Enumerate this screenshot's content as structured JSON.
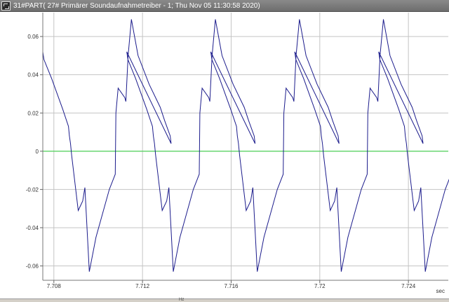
{
  "window": {
    "title": "31#PART( 27# Primärer Soundaufnahmetreiber - 1; Thu Nov 05 11:30:58 2020)"
  },
  "statusbar": {
    "text": "Hz"
  },
  "colors": {
    "signal": "#1c1c8c",
    "zero_line": "#3fd14a",
    "grid": "#c4c4c4",
    "plot_bg": "#ffffff"
  },
  "chart_data": {
    "type": "line",
    "xlabel": "sec",
    "ylabel": "",
    "xlim": [
      7.7075,
      7.7258
    ],
    "ylim": [
      -0.0675,
      0.0725
    ],
    "xticks": [
      "7.708",
      "7.712",
      "7.716",
      "7.72",
      "7.724"
    ],
    "xtick_values": [
      7.708,
      7.712,
      7.716,
      7.72,
      7.724
    ],
    "yticks": [
      "0.06",
      "0.04",
      "0.02",
      "0",
      "-0.02",
      "-0.04",
      "-0.06"
    ],
    "ytick_values": [
      0.06,
      0.04,
      0.02,
      0,
      -0.02,
      -0.04,
      -0.06
    ],
    "grid": true,
    "zero_line": true,
    "period": 0.00379,
    "series": [
      {
        "values_x": [
          7.7075,
          7.70755,
          7.7079,
          7.7084,
          7.70866,
          7.7087,
          7.70875,
          7.7088,
          7.7091,
          7.7093,
          7.7094,
          7.7096,
          7.7099,
          7.7105,
          7.71077,
          7.7108,
          7.7109,
          7.7112,
          7.71125,
          7.71135,
          7.7115,
          7.7118,
          7.7123,
          7.7128,
          7.713,
          7.71325,
          7.71329
        ],
        "values_y": [
          0.052,
          0.048,
          0.038,
          0.022,
          0.013,
          0.008,
          0.004,
          -0.002,
          -0.031,
          -0.026,
          -0.019,
          -0.063,
          -0.045,
          -0.02,
          -0.012,
          0.02,
          0.033,
          0.028,
          0.026,
          0.05,
          0.069,
          0.05,
          0.035,
          0.023,
          0.016,
          0.008,
          0.004
        ]
      }
    ]
  }
}
